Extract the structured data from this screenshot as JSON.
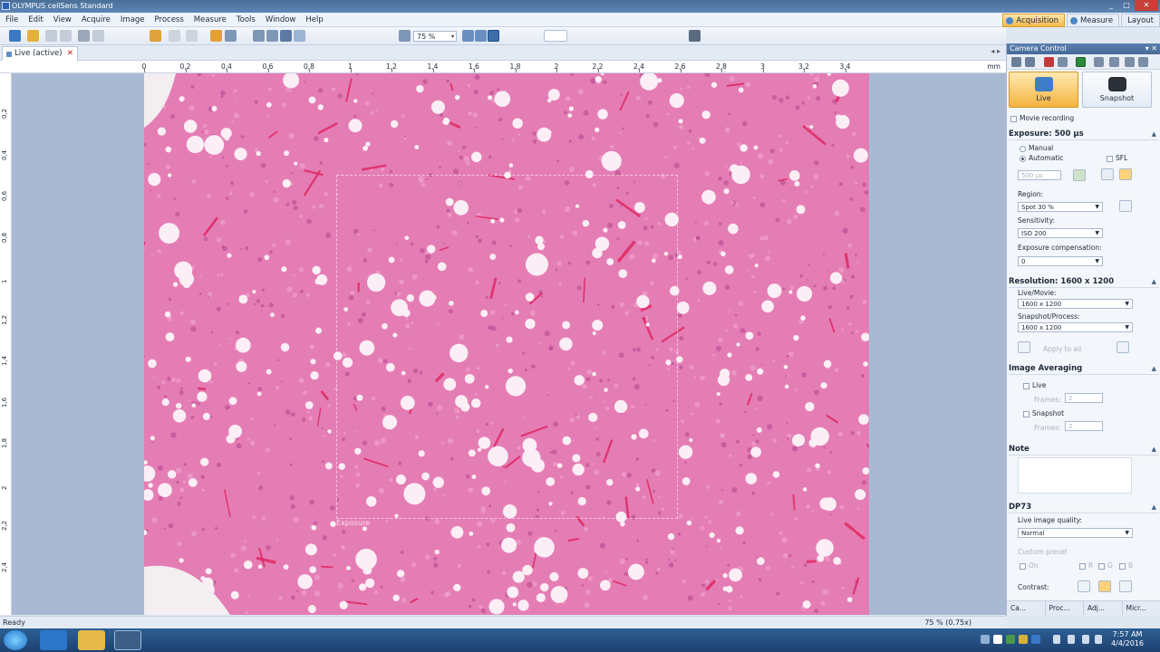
{
  "window": {
    "title": "OLYMPUS cellSens Standard",
    "controls": [
      "_",
      "□",
      "✕"
    ]
  },
  "menu": [
    "File",
    "Edit",
    "View",
    "Acquire",
    "Image",
    "Process",
    "Measure",
    "Tools",
    "Window",
    "Help"
  ],
  "modes": [
    {
      "label": "Acquisition",
      "active": true
    },
    {
      "label": "Measure",
      "active": false
    },
    {
      "label": "Layout",
      "active": false
    }
  ],
  "toolbar": {
    "zoom": "75 %"
  },
  "document": {
    "tab_label": "Live (active)",
    "close": "✕",
    "nav": "◂ ▸"
  },
  "ruler": {
    "unit": "mm",
    "x_ticks": [
      "0",
      "0,2",
      "0,4",
      "0,6",
      "0,8",
      "1",
      "1,2",
      "1,4",
      "1,6",
      "1,8",
      "2",
      "2,2",
      "2,4",
      "2,6",
      "2,8",
      "3",
      "3,2",
      "3,4"
    ],
    "y_ticks": [
      "0,2",
      "0,4",
      "0,6",
      "0,8",
      "1",
      "1,2",
      "1,4",
      "1,6",
      "1,8",
      "2",
      "2,2",
      "2,4"
    ]
  },
  "image": {
    "overlay_label": "Exposure",
    "description": "H&E stained liver tissue micrograph"
  },
  "status": {
    "left": "Ready",
    "zoom": "75 % (0.75x)"
  },
  "panel": {
    "title": "Camera Control",
    "title_controls": "▾ ✕",
    "live_label": "Live",
    "snapshot_label": "Snapshot",
    "movie_recording": "Movie recording",
    "exposure": {
      "header": "Exposure: 500 µs",
      "manual": "Manual",
      "automatic": "Automatic",
      "sfl": "SFL",
      "value": "500 µs",
      "region_label": "Region:",
      "region": "Spot 30 %",
      "sensitivity_label": "Sensitivity:",
      "sensitivity": "ISO 200",
      "comp_label": "Exposure compensation:",
      "comp": "0"
    },
    "resolution": {
      "header": "Resolution: 1600 x 1200",
      "live_label": "Live/Movie:",
      "live": "1600 x 1200",
      "snap_label": "Snapshot/Process:",
      "snap": "1600 x 1200",
      "apply": "Apply to all"
    },
    "averaging": {
      "header": "Image Averaging",
      "live": "Live",
      "frames_label": "Frames:",
      "frames_live": "2",
      "snapshot": "Snapshot",
      "frames_snap": "2"
    },
    "note": {
      "header": "Note"
    },
    "dp73": {
      "header": "DP73",
      "quality_label": "Live image quality:",
      "quality": "Normal",
      "custom_wb": "Custom preset",
      "on": "On",
      "r": "R",
      "g": "G",
      "b": "B",
      "contrast": "Contrast:"
    },
    "tabs": [
      "Ca...",
      "Proc...",
      "Adj...",
      "Micr..."
    ]
  },
  "taskbar": {
    "time": "7:57 AM",
    "date": "4/4/2016"
  },
  "colors": {
    "accent": "#f5b340",
    "title": "#4a6f98",
    "tissue": "#e07ab0"
  }
}
